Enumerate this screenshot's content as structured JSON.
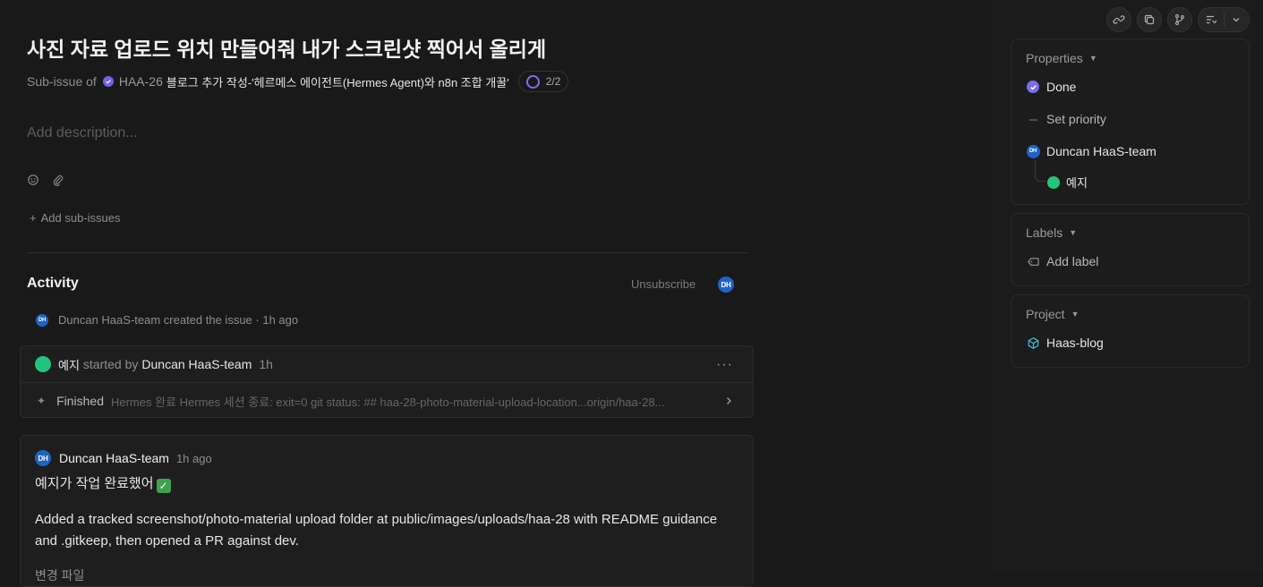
{
  "issue": {
    "title": "사진 자료 업로드 위치 만들어줘 내가 스크린샷 찍어서 올리게",
    "subissue_prefix": "Sub-issue of",
    "parent_id": "HAA-26",
    "parent_title": "블로그 추가 작성-'헤르메스 에이전트(Hermes Agent)와 n8n 조합 개꿀'",
    "progress": "2/2",
    "description_placeholder": "Add description...",
    "add_subissues_label": "Add sub-issues"
  },
  "activity": {
    "title": "Activity",
    "unsubscribe_label": "Unsubscribe",
    "subscriber_initials": "DH",
    "created_entry": {
      "initials": "DH",
      "text": "Duncan HaaS-team created the issue · 1h ago"
    },
    "agent_session": {
      "agent_name": "예지",
      "started_by_text": "started by",
      "user": "Duncan HaaS-team",
      "time": "1h",
      "more_label": "···",
      "status_label": "Finished",
      "log_text": "Hermes 완료 Hermes 세션 종료: exit=0 git status: ## haa-28-photo-material-upload-location...origin/haa-28..."
    },
    "comment": {
      "initials": "DH",
      "user": "Duncan HaaS-team",
      "time": "1h ago",
      "line1": "예지가 작업 완료했어",
      "emoji": "✓",
      "paragraph": "Added a tracked screenshot/photo-material upload folder at public/images/uploads/haa-28 with README guidance and .gitkeep, then opened a PR against dev.",
      "cut_line": "변경 파일"
    }
  },
  "sidebar": {
    "properties": {
      "header": "Properties",
      "status": "Done",
      "priority": "Set priority",
      "assignee_initials": "DH",
      "assignee": "Duncan HaaS-team",
      "agent": "예지"
    },
    "labels": {
      "header": "Labels",
      "add_label": "Add label"
    },
    "project": {
      "header": "Project",
      "name": "Haas-blog"
    }
  },
  "colors": {
    "accent": "#6f63e8",
    "agent_green": "#22c47d",
    "avatar_blue": "#1f63c6",
    "project_cyan": "#3fb6d6"
  }
}
